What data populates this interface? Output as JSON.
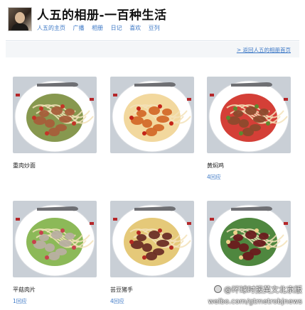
{
  "header": {
    "title": "人五的相册-一百种生活",
    "nav": [
      "人五的主页",
      "广播",
      "相册",
      "日记",
      "喜欢",
      "豆列"
    ]
  },
  "back_link": "> 返回人五的相册首页",
  "photos": [
    {
      "caption": "重肉炒面",
      "count": "",
      "food": "#a65e3a",
      "food2": "#7a8d3c",
      "accent": "#c33527"
    },
    {
      "caption": "",
      "count": "",
      "food": "#d36a2a",
      "food2": "#f1d493",
      "accent": "#c42418"
    },
    {
      "caption": "黄焖鸡",
      "count": "4回应",
      "food": "#8c4a2c",
      "food2": "#cf2a21",
      "accent": "#5d8a2e"
    },
    {
      "caption": "平菇肉片",
      "count": "1回应",
      "food": "#b9afa2",
      "food2": "#7fb146",
      "accent": "#c7424c"
    },
    {
      "caption": "芸豆猪手",
      "count": "4回应",
      "food": "#6b2f26",
      "food2": "#e2c36a",
      "accent": "#b42a22"
    },
    {
      "caption": "",
      "count": "",
      "food": "#6a1b1d",
      "food2": "#3c7a2a",
      "accent": "#f0d28a"
    }
  ],
  "watermark": {
    "line1": "@环球时报英文北京版",
    "line2": "weibo.com/gtmetrobjnews"
  },
  "colors": {
    "link": "#3c78c6",
    "bg": "#ffffff",
    "plate": "#ffffff"
  }
}
